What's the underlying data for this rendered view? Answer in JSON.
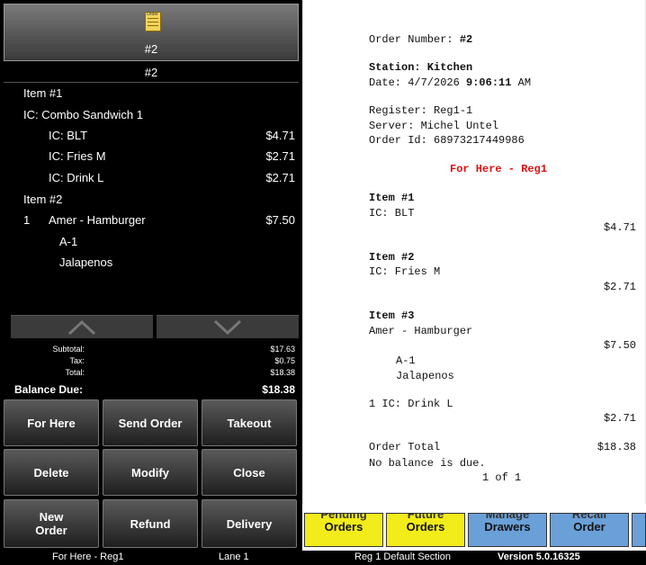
{
  "pos": {
    "order_tile_number": "#2",
    "order_tile_icon_text": "Order",
    "order_header": "#2",
    "lines": [
      {
        "text": "Item #1",
        "price": ""
      },
      {
        "text": "IC: Combo Sandwich 1",
        "price": ""
      },
      {
        "text": "IC: BLT",
        "price": "$4.71"
      },
      {
        "text": "IC: Fries M",
        "price": "$2.71"
      },
      {
        "text": "IC: Drink L",
        "price": "$2.71"
      },
      {
        "text": "Item #2",
        "price": ""
      },
      {
        "qty": "1",
        "text": "Amer - Hamburger",
        "price": "$7.50"
      },
      {
        "text": "A-1",
        "price": ""
      },
      {
        "text": "Jalapenos",
        "price": ""
      }
    ],
    "totals": {
      "subtotal_label": "Subtotal:",
      "subtotal": "$17.63",
      "tax_label": "Tax:",
      "tax": "$0.75",
      "total_label": "Total:",
      "total": "$18.38",
      "balance_label": "Balance Due:",
      "balance": "$18.38"
    },
    "buttons": {
      "for_here": "For Here",
      "send_order": "Send Order",
      "takeout": "Takeout",
      "delete": "Delete",
      "modify": "Modify",
      "close": "Close",
      "new_order_1": "New",
      "new_order_2": "Order",
      "refund": "Refund",
      "delivery": "Delivery"
    }
  },
  "function_buttons": [
    {
      "top": "Pending",
      "label": "Orders",
      "color": "#f2ec1a"
    },
    {
      "top": "Future",
      "label": "Orders",
      "color": "#f2ec1a"
    },
    {
      "top": "Manage",
      "label": "Drawers",
      "color": "#6aa0d8"
    },
    {
      "top": "Recall",
      "label": "Order",
      "color": "#6aa0d8"
    }
  ],
  "status_bar": {
    "mode": "For Here - Reg1",
    "lane": "Lane 1",
    "section": "Reg 1 Default Section",
    "version": "Version 5.0.16325"
  },
  "receipt": {
    "order_number_label": "Order Number:",
    "order_number": "#2",
    "station": "Station: Kitchen",
    "date_label": "Date: 4/7/2026",
    "time": "9:06:11",
    "ampm": "AM",
    "register": "Register: Reg1-1",
    "server": "Server: Michel Untel",
    "order_id": "Order Id: 68973217449986",
    "mode": "For Here - Reg1",
    "items": [
      {
        "header": "Item #1",
        "name": "IC: BLT",
        "price": "$4.71"
      },
      {
        "header": "Item #2",
        "name": "IC: Fries M",
        "price": "$2.71"
      },
      {
        "header": "Item #3",
        "name": "Amer - Hamburger",
        "price": "$7.50",
        "modifiers": [
          "A-1",
          "Jalapenos"
        ]
      }
    ],
    "extra_line": "1 IC: Drink L",
    "extra_price": "$2.71",
    "total_label": "Order Total",
    "total": "$18.38",
    "balance_note": "No balance is due.",
    "page": "1 of 1"
  }
}
